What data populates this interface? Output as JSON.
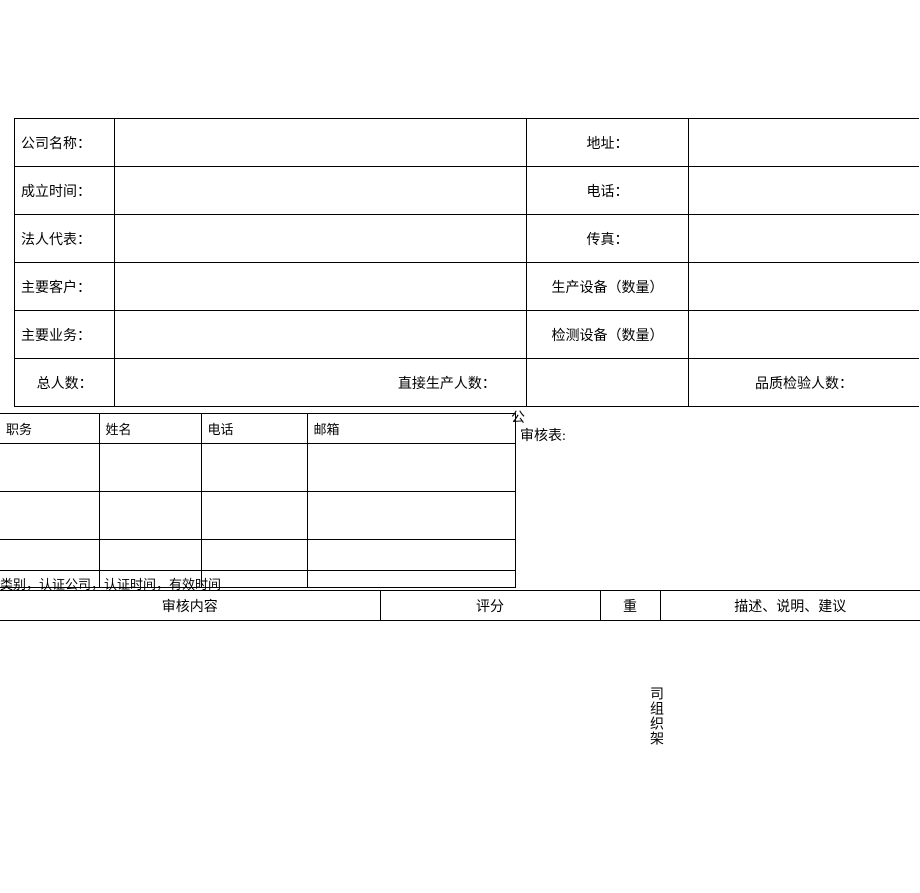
{
  "main_table": {
    "company_name_label": "公司名称：",
    "address_label": "地址：",
    "founded_label": "成立时间：",
    "phone_label": "电话：",
    "legal_rep_label": "法人代表：",
    "fax_label": "传真：",
    "main_customer_label": "主要客户：",
    "prod_equip_label": "生产设备（数量）",
    "main_business_label": "主要业务：",
    "test_equip_label": "检测设备（数量）",
    "total_people_label": "总人数：",
    "direct_prod_label": "直接生产人数：",
    "quality_inspect_label": "品质检验人数："
  },
  "contact_table": {
    "position_header": "职务",
    "name_header": "姓名",
    "phone_header": "电话",
    "email_header": "邮箱"
  },
  "cert_text": "类别，认证公司，认证时间，有效时间",
  "audit_header": {
    "content": "审核内容",
    "score": "评分",
    "weight": "重",
    "description": "描述、说明、建议"
  },
  "float_company": "公",
  "float_audit_table": "审核表:",
  "vertical_org": "司组织架"
}
